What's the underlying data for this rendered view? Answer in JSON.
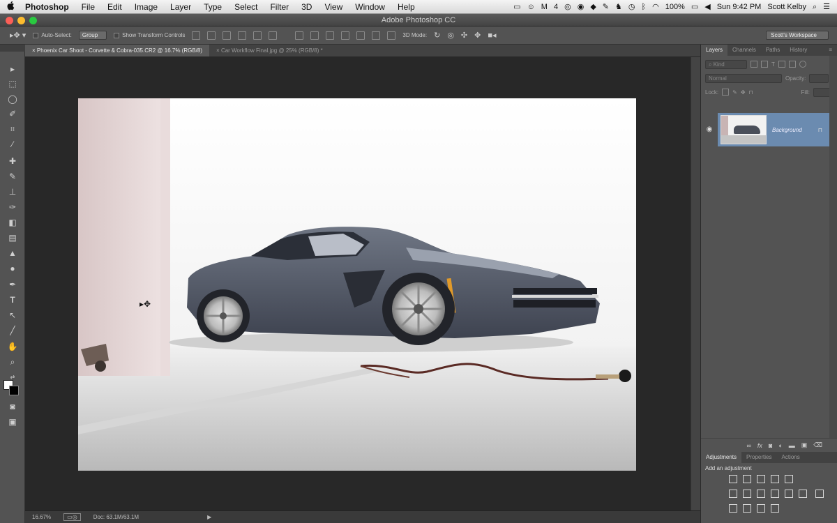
{
  "menubar": {
    "apple": "",
    "app": "Photoshop",
    "items": [
      "File",
      "Edit",
      "Image",
      "Layer",
      "Type",
      "Select",
      "Filter",
      "3D",
      "View",
      "Window",
      "Help"
    ],
    "status": {
      "badge": "4",
      "battery": "100%",
      "time": "Sun 9:42 PM",
      "user": "Scott Kelby"
    }
  },
  "window": {
    "title": "Adobe Photoshop CC"
  },
  "options": {
    "auto_select": "Auto-Select:",
    "group": "Group",
    "transform": "Show Transform Controls",
    "mode3d": "3D Mode:",
    "workspace": "Scott's Workspace"
  },
  "tabs": [
    {
      "label": "Phoenix Car Shoot - Corvette & Cobra-035.CR2 @ 16.7% (RGB/8)"
    },
    {
      "label": "Car Workflow Final.jpg @ 25% (RGB/8) *"
    }
  ],
  "status": {
    "zoom": "16.67%",
    "doc": "Doc: 63.1M/63.1M"
  },
  "layers": {
    "tabs": [
      "Layers",
      "Channels",
      "Paths",
      "History"
    ],
    "kind": "Kind",
    "blend": "Normal",
    "opacity_label": "Opacity:",
    "lock_label": "Lock:",
    "fill_label": "Fill:",
    "layer_name": "Background"
  },
  "adjustments": {
    "tabs": [
      "Adjustments",
      "Properties",
      "Actions"
    ],
    "heading": "Add an adjustment"
  }
}
